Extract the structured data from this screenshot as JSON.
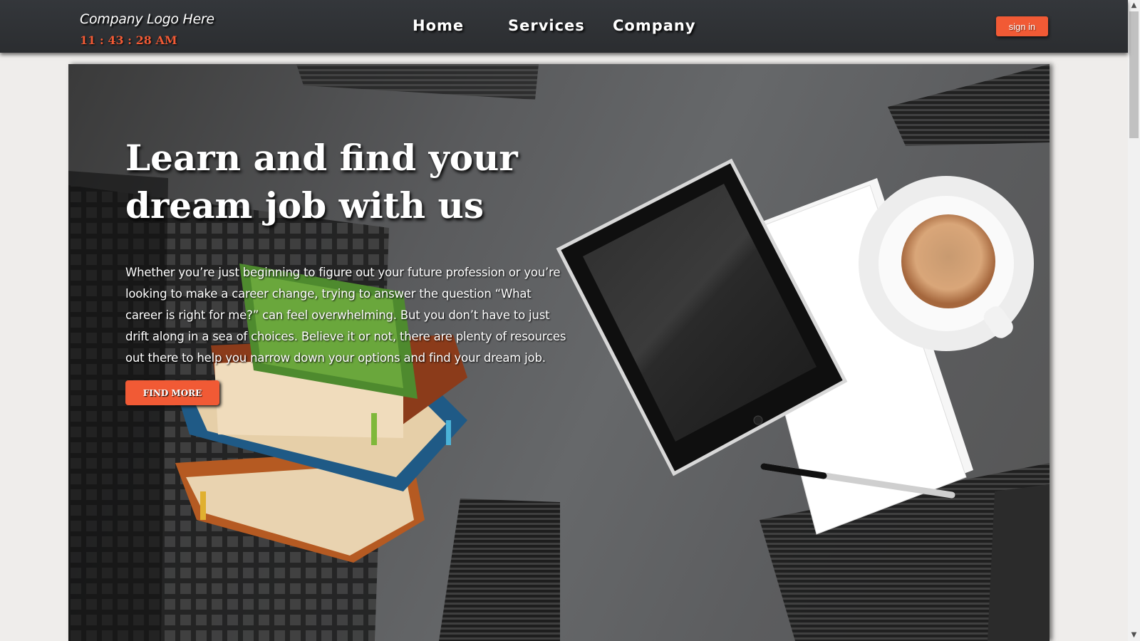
{
  "header": {
    "logo": "Company Logo Here",
    "clock": "11 : 43 : 28 AM",
    "nav": [
      "Home",
      "Services",
      "Company"
    ],
    "signin_label": "sign in"
  },
  "hero": {
    "title": "Learn and find your dream job with us",
    "description": "Whether you’re just beginning to figure out your future profession or you’re looking to make a career change, trying to answer the question “What career is right for me?” can feel overwhelming. But you don’t have to just drift along in a sea of choices. Believe it or not, there are plenty of resources out there to help you narrow down your options and find your dream job.",
    "button_label": "FIND MORE"
  },
  "colors": {
    "accent": "#f15a35",
    "topbar": "#2f3134",
    "page_bg": "#efedeb"
  }
}
